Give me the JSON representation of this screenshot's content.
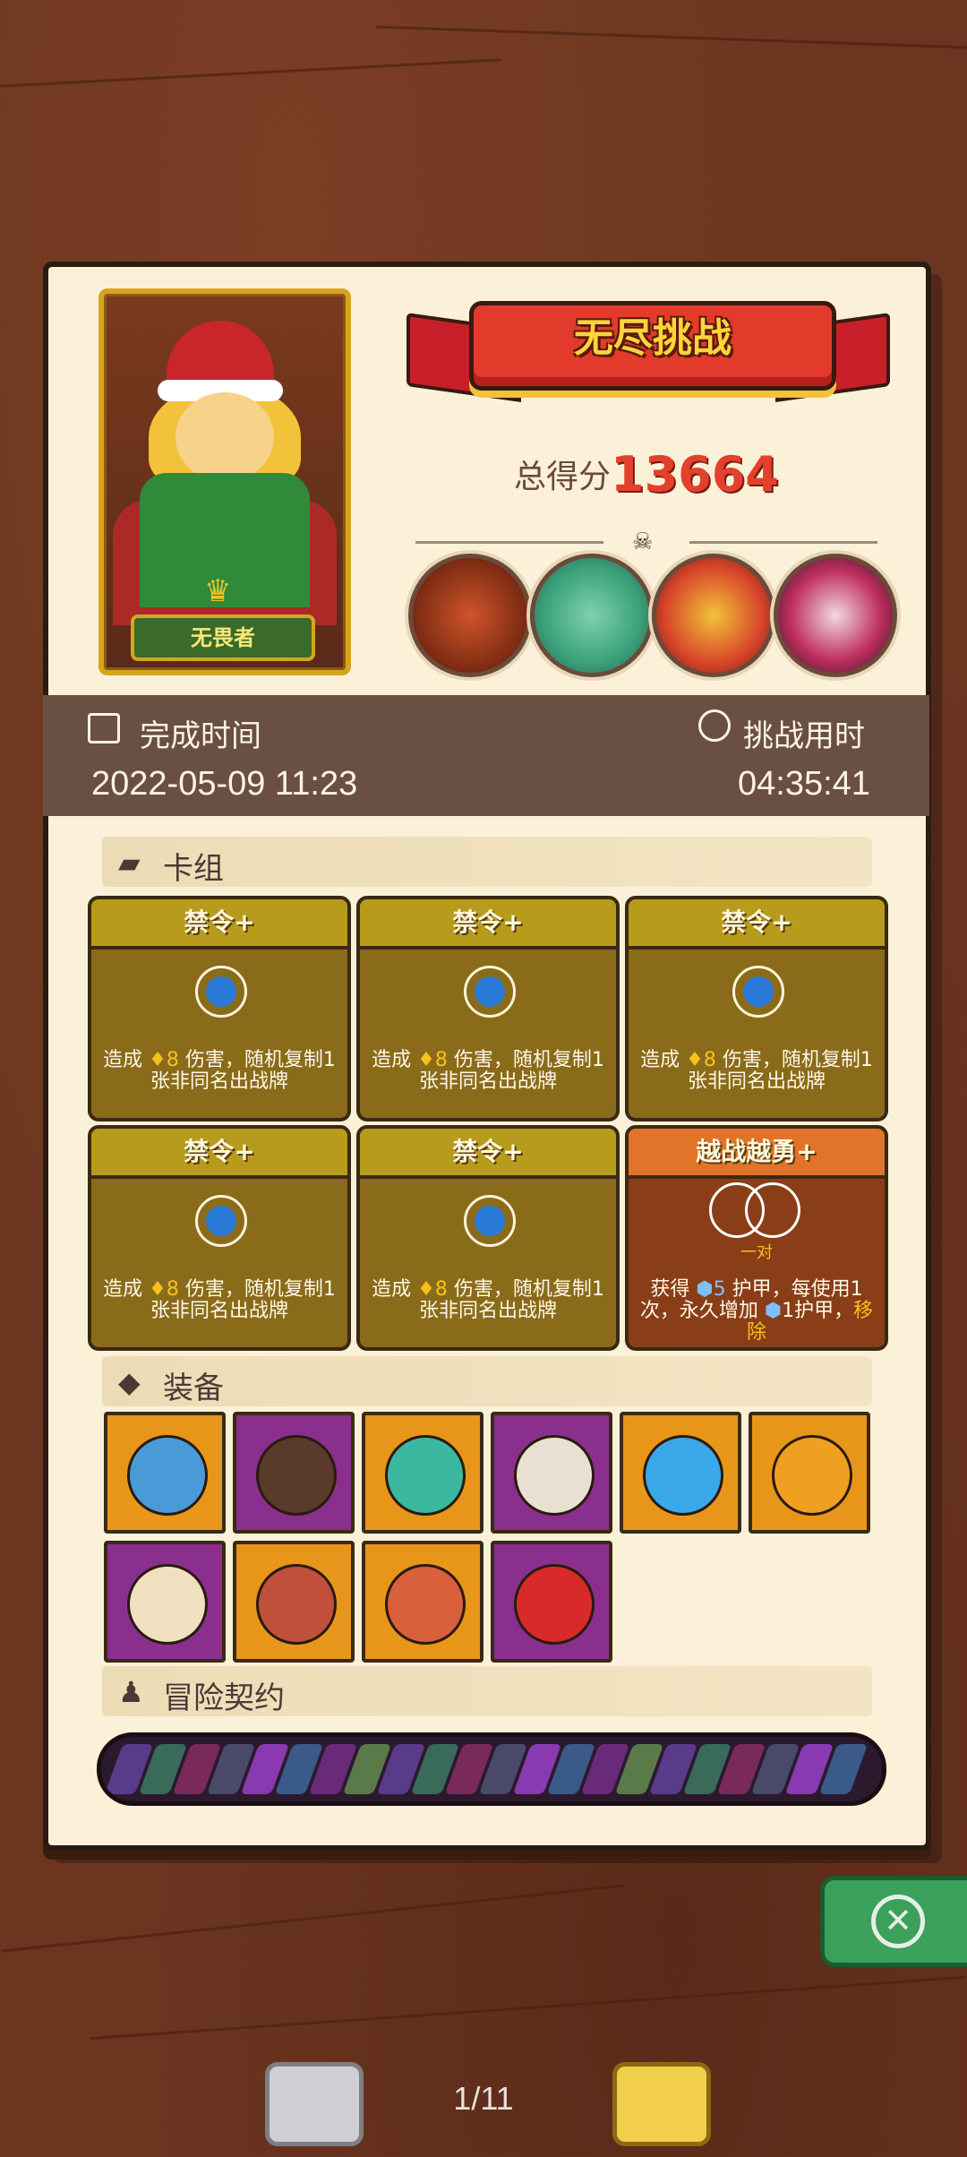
{
  "header": {
    "character_name": "无畏者",
    "mode_title": "无尽挑战",
    "score_label": "总得分",
    "score_value": "13664"
  },
  "bosses": [
    "boss-cyclops-icon",
    "boss-dragon-icon",
    "boss-mask-icon",
    "boss-vampire-icon"
  ],
  "info": {
    "finish_label": "完成时间",
    "finish_value": "2022-05-09 11:23",
    "duration_label": "挑战用时",
    "duration_value": "04:35:41"
  },
  "deck": {
    "title": "卡组",
    "cards": [
      {
        "name": "禁令+",
        "desc_pre": "造成 ",
        "desc_num": "8",
        "desc_post": " 伤害，随机复制1张非同名出战牌"
      },
      {
        "name": "禁令+",
        "desc_pre": "造成 ",
        "desc_num": "8",
        "desc_post": " 伤害，随机复制1张非同名出战牌"
      },
      {
        "name": "禁令+",
        "desc_pre": "造成 ",
        "desc_num": "8",
        "desc_post": " 伤害，随机复制1张非同名出战牌"
      },
      {
        "name": "禁令+",
        "desc_pre": "造成 ",
        "desc_num": "8",
        "desc_post": " 伤害，随机复制1张非同名出战牌"
      },
      {
        "name": "禁令+",
        "desc_pre": "造成 ",
        "desc_num": "8",
        "desc_post": " 伤害，随机复制1张非同名出战牌"
      },
      {
        "name": "越战越勇+",
        "sub": "一对",
        "desc_pre": "获得 ",
        "desc_num": "5",
        "desc_post": " 护甲，每使用1次，永久增加 ",
        "desc_num2": "1",
        "desc_post2": "护甲，",
        "desc_remove": "移除"
      }
    ]
  },
  "equipment": {
    "title": "装备",
    "items": [
      {
        "icon": "mushroom-icon",
        "bg": "#e8961a"
      },
      {
        "icon": "button-icon",
        "bg": "#8b2f8e"
      },
      {
        "icon": "flame-crystal-icon",
        "bg": "#e8961a"
      },
      {
        "icon": "mirror-icon",
        "bg": "#8b2f8e"
      },
      {
        "icon": "ice-dice-icon",
        "bg": "#e8961a"
      },
      {
        "icon": "fire-dice-icon",
        "bg": "#e8961a"
      },
      {
        "icon": "spiked-dice-icon",
        "bg": "#8b2f8e"
      },
      {
        "icon": "pie-icon",
        "bg": "#e8961a"
      },
      {
        "icon": "meat-icon",
        "bg": "#e8961a"
      },
      {
        "icon": "potion-icon",
        "bg": "#8b2f8e"
      }
    ]
  },
  "contract": {
    "title": "冒险契约"
  },
  "pager": {
    "text": "1/11"
  }
}
